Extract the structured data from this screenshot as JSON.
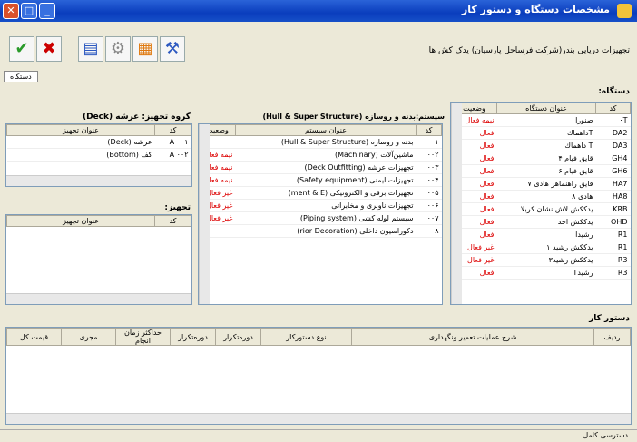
{
  "window": {
    "title": "مشخصات دستگاه و دستور کار"
  },
  "header": {
    "subtitle": "تجهیزات دریایی بندر(شرکت فرساحل پارسیان) یدک کش ها"
  },
  "tabs": [
    {
      "label": "دستگاه"
    }
  ],
  "devices": {
    "label": "دستگاه:",
    "columns": {
      "code": "کد",
      "name": "عنوان دستگاه",
      "status": "وضعیت"
    },
    "rows": [
      {
        "code": "۰T",
        "name": "صنورا",
        "status": "نیمه فعال"
      },
      {
        "code": "DA2",
        "name": "Tداهماك",
        "status": "فعال"
      },
      {
        "code": "DA3",
        "name": "T داهماك",
        "status": "فعال"
      },
      {
        "code": "GH4",
        "name": "قایق فیام ۴",
        "status": "فعال"
      },
      {
        "code": "GH6",
        "name": "قایق فیام ۶",
        "status": "فعال"
      },
      {
        "code": "HA7",
        "name": "قایق راهنماهر هادی ۷",
        "status": "فعال"
      },
      {
        "code": "HA8",
        "name": "هادی ۸",
        "status": "فعال"
      },
      {
        "code": "KRB",
        "name": "یدککش لاش نشان کربلا",
        "status": "فعال"
      },
      {
        "code": "OHD",
        "name": "یدککش احد",
        "status": "فعال"
      },
      {
        "code": "R1",
        "name": "رشیدا",
        "status": "فعال"
      },
      {
        "code": "R1",
        "name": "یدککش رشید ۱",
        "status": "غیر فعال"
      },
      {
        "code": "R3",
        "name": "یدککش رشید۳",
        "status": "غیر فعال"
      },
      {
        "code": "R3",
        "name": "رشیدT",
        "status": "فعال"
      }
    ]
  },
  "systems": {
    "label": "سیستم:بدنه و روسازه (Hull & Super Structure)",
    "columns": {
      "code": "کد",
      "name": "عنوان سیستم",
      "status": "وضعیت"
    },
    "rows": [
      {
        "code": "۰۰۱",
        "name": "بدنه و روسازه (Hull & Super Structure)",
        "status": ""
      },
      {
        "code": "۰۰۲",
        "name": "ماشین‌آلات (Machinary)",
        "status": "نیمه فعال"
      },
      {
        "code": "۰۰۳",
        "name": "تجهیزات عرشه (Deck Outfitting)",
        "status": "نیمه فعال"
      },
      {
        "code": "۰۰۴",
        "name": "تجهیزات ایمنی (Safety equipment)",
        "status": "نیمه فعال"
      },
      {
        "code": "۰۰۵",
        "name": "تجهیزات برقی و الکترونیکی (ment & E)",
        "status": "غیر فعال"
      },
      {
        "code": "۰۰۶",
        "name": "تجهیزات ناوبری و مخابراتی",
        "status": "غیر فعال"
      },
      {
        "code": "۰۰۷",
        "name": "سیستم لوله کشی (Piping system)",
        "status": "غیر فعال"
      },
      {
        "code": "۰۰۸",
        "name": "دکوراسیون داخلی (rior Decoration)",
        "status": ""
      }
    ]
  },
  "groups": {
    "label": "گروه تجهیز: عرشه (Deck)",
    "columns": {
      "code": "کد",
      "name": "عنوان تجهیز"
    },
    "rows": [
      {
        "code": "A ۰۰۱",
        "name": "عرشه (Deck)"
      },
      {
        "code": "A ۰۰۲",
        "name": "کف (Bottom)"
      }
    ]
  },
  "equipment": {
    "label": "تجهیز:",
    "columns": {
      "code": "کد",
      "name": "عنوان تجهیز"
    }
  },
  "workorders": {
    "label": "دستور کار",
    "columns": {
      "row": "ردیف",
      "desc": "شرح عملیات تعمیر ونگهداری",
      "type": "نوع دستورکار",
      "period": "دوره‌تکرار",
      "period2": "دوره‌تکرار",
      "maxtime": "حداکثر زمان انجام",
      "executor": "مجری",
      "total": "قیمت کل"
    }
  },
  "status": {
    "text": "دسترسی کامل"
  }
}
